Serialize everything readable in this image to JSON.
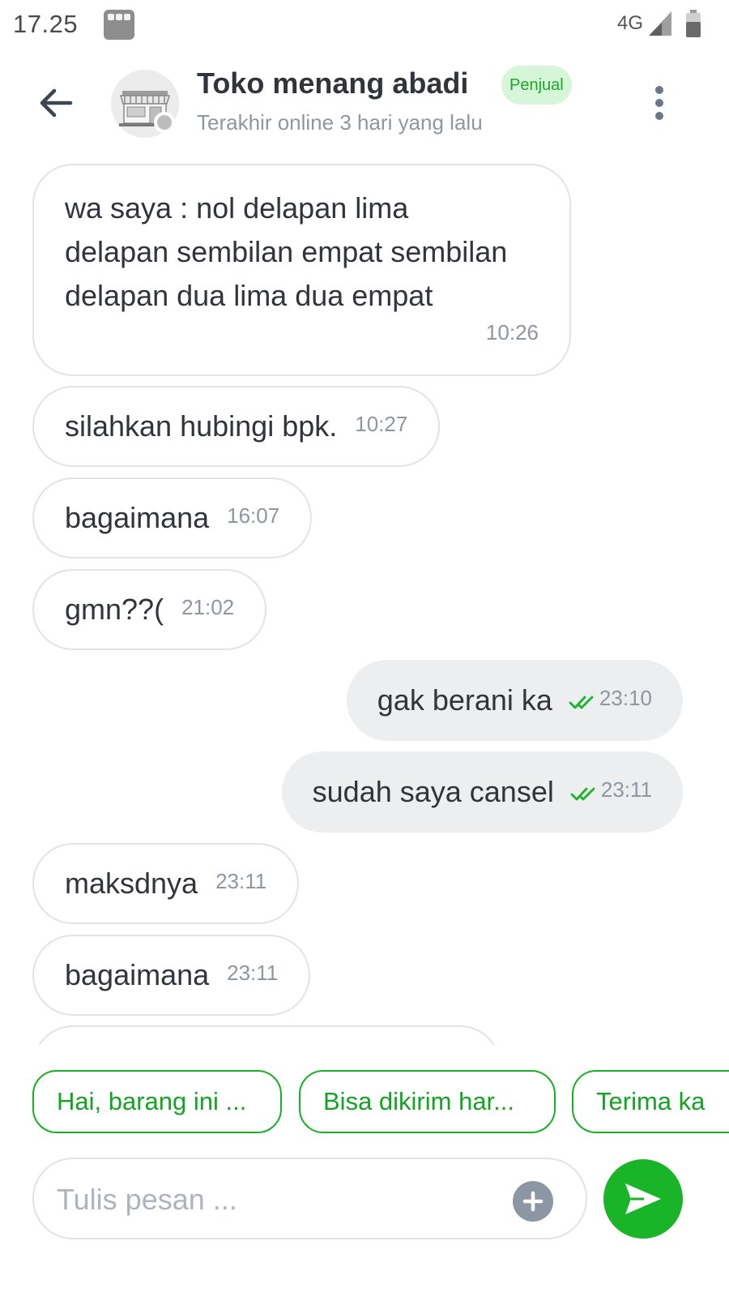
{
  "status_bar": {
    "time": "17.25",
    "network": "4G"
  },
  "header": {
    "shop_name": "Toko menang abadi",
    "badge": "Penjual",
    "last_online": "Terakhir online 3 hari yang lalu",
    "icons": {
      "back": "arrow-left-icon",
      "menu": "more-vertical-icon",
      "avatar": "shop-storefront-icon"
    }
  },
  "messages": [
    {
      "direction": "in",
      "text": "wa saya : nol delapan lima delapan sembilan empat sembilan delapan dua lima dua empat",
      "time": "10:26"
    },
    {
      "direction": "in",
      "text": "silahkan hubingi bpk.",
      "time": "10:27"
    },
    {
      "direction": "in",
      "text": "bagaimana",
      "time": "16:07"
    },
    {
      "direction": "in",
      "text": "gmn??(",
      "time": "21:02"
    },
    {
      "direction": "out",
      "text": "gak berani ka",
      "time": "23:10",
      "status": "read"
    },
    {
      "direction": "out",
      "text": "sudah saya cansel",
      "time": "23:11",
      "status": "read"
    },
    {
      "direction": "in",
      "text": "maksdnya",
      "time": "23:11"
    },
    {
      "direction": "in",
      "text": "bagaimana",
      "time": "23:11"
    }
  ],
  "quick_replies": [
    "Hai, barang ini ...",
    "Bisa dikirim har...",
    "Terima ka"
  ],
  "composer": {
    "placeholder": "Tulis pesan ...",
    "value": ""
  },
  "colors": {
    "accent": "#19b427",
    "badge_bg": "#d6f5d9",
    "outgoing_bg": "#edeeef",
    "read_check": "#19b427"
  }
}
